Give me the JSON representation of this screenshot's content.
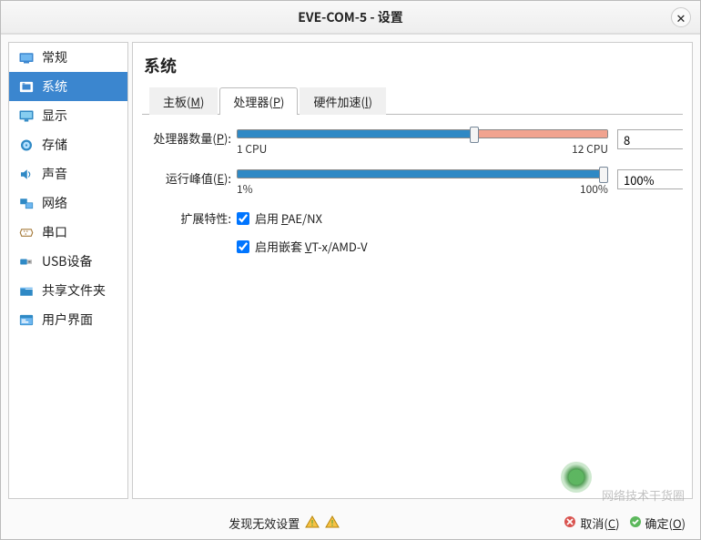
{
  "window": {
    "title": "EVE-COM-5 - 设置"
  },
  "sidebar": {
    "items": [
      {
        "label": "常规",
        "icon": "general"
      },
      {
        "label": "系统",
        "icon": "system"
      },
      {
        "label": "显示",
        "icon": "display"
      },
      {
        "label": "存储",
        "icon": "storage"
      },
      {
        "label": "声音",
        "icon": "audio"
      },
      {
        "label": "网络",
        "icon": "network"
      },
      {
        "label": "串口",
        "icon": "serial"
      },
      {
        "label": "USB设备",
        "icon": "usb"
      },
      {
        "label": "共享文件夹",
        "icon": "shared"
      },
      {
        "label": "用户界面",
        "icon": "ui"
      }
    ],
    "selected_index": 1
  },
  "main": {
    "heading": "系统",
    "tabs": [
      {
        "label": "主板",
        "mnemonic": "M"
      },
      {
        "label": "处理器",
        "mnemonic": "P"
      },
      {
        "label": "硬件加速",
        "mnemonic": "l"
      }
    ],
    "active_tab": 1,
    "cpu": {
      "label": "处理器数量",
      "mnemonic": "P",
      "min_label": "1 CPU",
      "max_label": "12 CPU",
      "value": "8",
      "slider_min": 1,
      "slider_max": 12,
      "slider_value": 8,
      "blue_end_pct": 66,
      "green_end_pct": 41,
      "red_start_pct": 41
    },
    "cap": {
      "label": "运行峰值",
      "mnemonic": "E",
      "min_label": "1%",
      "max_label": "100%",
      "value": "100%",
      "blue_end_pct": 100,
      "green_start_pct": 0,
      "red_start_pct": 44
    },
    "ext": {
      "label": "扩展特性:",
      "pae": {
        "checked": true,
        "text": "启用 PAE/NX",
        "mnemonic_part": "P"
      },
      "vt": {
        "checked": true,
        "text_before": "启用嵌套 ",
        "mnemonic": "V",
        "text_after": "T-x/AMD-V"
      }
    }
  },
  "footer": {
    "invalid_text": "发现无效设置",
    "cancel": "取消",
    "cancel_mn": "C",
    "ok": "确定",
    "ok_mn": "O"
  },
  "watermark": "网络技术干货圈"
}
